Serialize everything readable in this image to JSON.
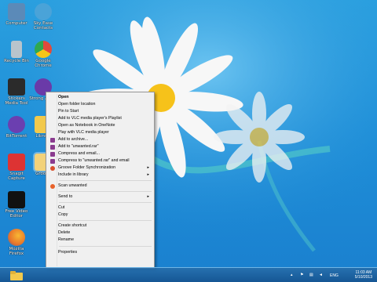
{
  "desktop_icons": [
    {
      "label": "Computer",
      "icon": "computer-icon",
      "color": "#5b8ab8"
    },
    {
      "label": "Sky Ease Contacts",
      "icon": "contacts-app-icon",
      "color": "#4aa3d8"
    },
    {
      "label": "Recycle Bin",
      "icon": "recycle-bin-icon",
      "color": "#b8c4cc"
    },
    {
      "label": "Google Chrome",
      "icon": "chrome-icon",
      "color": "#e24a3b"
    },
    {
      "label": "Stickers Media Tool",
      "icon": "media-tool-icon",
      "color": "#2b2b2b"
    },
    {
      "label": "Strong Audio",
      "icon": "audio-app-icon",
      "color": "#6a3aa8"
    },
    {
      "label": "BitTorrent",
      "icon": "bittorrent-icon",
      "color": "#6b3fb0"
    },
    {
      "label": "Library",
      "icon": "folder-icon",
      "color": "#f2c94c"
    },
    {
      "label": "Snagit Capture",
      "icon": "snagit-icon",
      "color": "#d33"
    },
    {
      "label": "Groove",
      "icon": "folder-icon",
      "color": "#f2d27a"
    },
    {
      "label": "Free Video Editor",
      "icon": "video-editor-icon",
      "color": "#111"
    },
    {
      "label": "Mozilla Firefox",
      "icon": "firefox-icon",
      "color": "#e8742a"
    }
  ],
  "context_menu": {
    "items": [
      {
        "label": "Open",
        "bold": true
      },
      {
        "label": "Open folder location"
      },
      {
        "label": "Pin to Start"
      },
      {
        "label": "Add to VLC media player's Playlist"
      },
      {
        "label": "Open as Notebook in OneNote"
      },
      {
        "label": "Play with VLC media player"
      },
      {
        "label": "Add to archive...",
        "icon": "winrar-icon"
      },
      {
        "label": "Add to \"unwanted.rar\"",
        "icon": "winrar-icon"
      },
      {
        "label": "Compress and email...",
        "icon": "winrar-icon"
      },
      {
        "label": "Compress to \"unwanted.rar\" and email",
        "icon": "winrar-icon"
      },
      {
        "label": "Groove Folder Synchronization",
        "submenu": true,
        "icon": "groove-icon"
      },
      {
        "label": "Include in library",
        "submenu": true
      },
      {
        "separator": true
      },
      {
        "label": "Scan unwanted",
        "icon": "antivirus-icon"
      },
      {
        "separator": true
      },
      {
        "label": "Send to",
        "submenu": true
      },
      {
        "separator": true
      },
      {
        "label": "Cut"
      },
      {
        "label": "Copy"
      },
      {
        "separator": true
      },
      {
        "label": "Create shortcut"
      },
      {
        "label": "Delete"
      },
      {
        "label": "Rename"
      },
      {
        "separator": true
      },
      {
        "label": "Properties"
      }
    ],
    "submenu_arrow": "▸"
  },
  "taskbar": {
    "language": "ENG",
    "time": "11:03 AM",
    "date": "5/10/2013"
  },
  "colors": {
    "sky": "#1f8fd8",
    "menu_bg": "#f0f0f0"
  }
}
